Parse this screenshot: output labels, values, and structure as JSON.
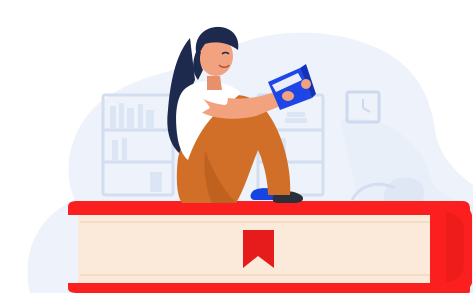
{
  "illustration": {
    "subject": "woman-reading-book-icon",
    "colors": {
      "background_blob": "#eef3fb",
      "background_blob_edge": "#e3ebf7",
      "shelf_lines": "#d3def0",
      "book_cover_red": "#fc1f1f",
      "book_cover_red_dark": "#d81616",
      "book_pages": "#fbe9d9",
      "bookmark_red": "#e61b1b",
      "hair": "#1d2a4d",
      "skin": "#f3a27f",
      "shirt": "#ffffff",
      "pants": "#d16f28",
      "pants_shadow": "#b35a1a",
      "shoes": "#1545e0",
      "reading_book_blue": "#1e45e6"
    }
  }
}
